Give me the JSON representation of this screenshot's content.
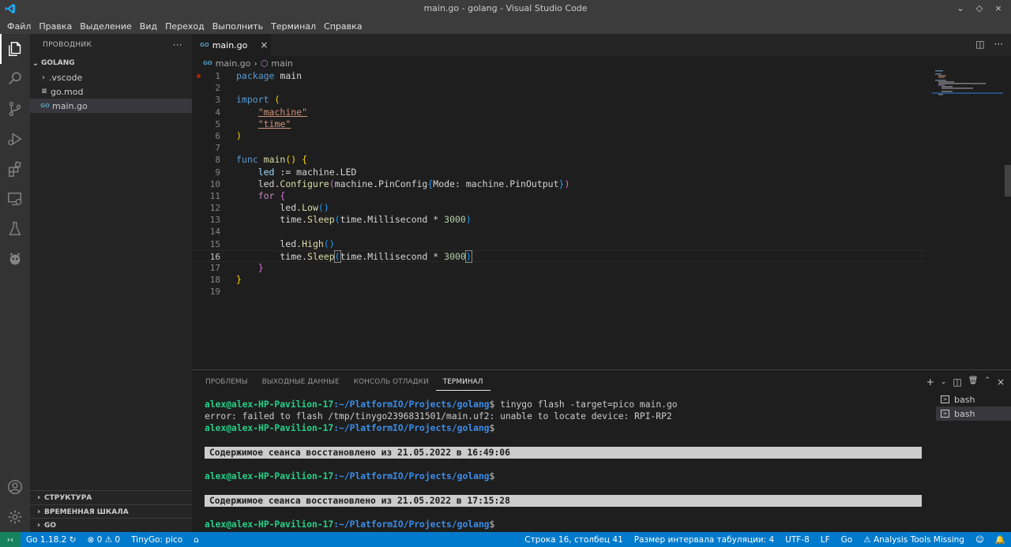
{
  "window": {
    "title": "main.go - golang - Visual Studio Code"
  },
  "menu": [
    "Файл",
    "Правка",
    "Выделение",
    "Вид",
    "Переход",
    "Выполнить",
    "Терминал",
    "Справка"
  ],
  "activity": [
    "explorer-icon",
    "search-icon",
    "source-control-icon",
    "run-debug-icon",
    "extensions-icon",
    "remote-explorer-icon",
    "testing-icon",
    "platformio-icon",
    "account-icon",
    "settings-gear-icon"
  ],
  "sidebar": {
    "header": "ПРОВОДНИК",
    "more": "···",
    "folder": "GOLANG",
    "items": [
      {
        "label": ".vscode",
        "kind": "folder"
      },
      {
        "label": "go.mod",
        "kind": "file",
        "icon": "≡"
      },
      {
        "label": "main.go",
        "kind": "file",
        "icon": "GO"
      }
    ],
    "sections": [
      "СТРУКТУРА",
      "ВРЕМЕННАЯ ШКАЛА",
      "GO"
    ]
  },
  "editor": {
    "tab": {
      "label": "main.go",
      "icon": "GO",
      "close": "×"
    },
    "breadcrumb": {
      "file": "main.go",
      "symbol": "main"
    },
    "cursor_line": 16,
    "line_numbers": [
      "1",
      "2",
      "3",
      "4",
      "5",
      "6",
      "7",
      "8",
      "9",
      "10",
      "11",
      "12",
      "13",
      "14",
      "15",
      "16",
      "17",
      "18",
      "19"
    ]
  },
  "panel": {
    "tabs": [
      "ПРОБЛЕМЫ",
      "ВЫХОДНЫЕ ДАННЫЕ",
      "КОНСОЛЬ ОТЛАДКИ",
      "ТЕРМИНАЛ"
    ],
    "active_tab": "ТЕРМИНАЛ",
    "prompt_user": "alex@alex-HP-Pavilion-17",
    "prompt_path": ":~/PlatformIO/Projects/golang",
    "prompt_symbol": "$",
    "command": " tinygo flash -target=pico main.go",
    "error": "error: failed to flash /tmp/tinygo2396831501/main.uf2: unable to locate device: RPI-RP2",
    "banner1": "Содержимое сеанса восстановлено из 21.05.2022 в 16:49:06",
    "banner2": "Содержимое сеанса восстановлено из 21.05.2022 в 17:15:28",
    "terminals": [
      "bash",
      "bash"
    ]
  },
  "statusbar": {
    "go_version": "Go 1.18.2",
    "errors": "0",
    "warnings": "0",
    "tinygo": "TinyGo: pico",
    "position": "Строка 16, столбец 41",
    "indent": "Размер интервала табуляции: 4",
    "encoding": "UTF-8",
    "eol": "LF",
    "language": "Go",
    "analysis": "Analysis Tools Missing"
  }
}
